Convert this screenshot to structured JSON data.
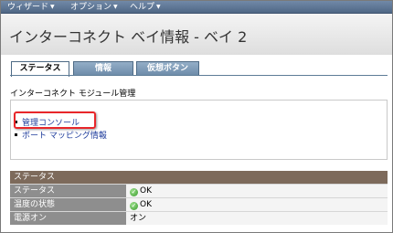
{
  "menu": {
    "items": [
      {
        "label": "ウィザード"
      },
      {
        "label": "オプション"
      },
      {
        "label": "ヘルプ"
      }
    ]
  },
  "page": {
    "title": "インターコネクト ベイ情報 - ベイ 2"
  },
  "tabs": [
    {
      "label": "ステータス",
      "active": true
    },
    {
      "label": "情報",
      "active": false
    },
    {
      "label": "仮想ボタン",
      "active": false
    }
  ],
  "section": {
    "label": "インターコネクト モジュール管理"
  },
  "links": [
    {
      "label": "管理コンソール",
      "highlighted": true
    },
    {
      "label": "ポート マッピング情報",
      "highlighted": false
    }
  ],
  "status": {
    "header": "ステータス",
    "rows": [
      {
        "label": "ステータス",
        "value": "OK",
        "icon": "ok-check-icon"
      },
      {
        "label": "温度の状態",
        "value": "OK",
        "icon": "ok-check-icon"
      },
      {
        "label": "電源オン",
        "value": "オン",
        "icon": ""
      }
    ]
  },
  "colors": {
    "menubar": "#4f6785",
    "tab_inactive": "#6c8aa8",
    "status_header": "#7d6a5b",
    "status_label_bg": "#8e8e8e",
    "highlight": "#e8262a",
    "link": "#1f3d9c",
    "ok_icon": "#3a9a2d"
  }
}
